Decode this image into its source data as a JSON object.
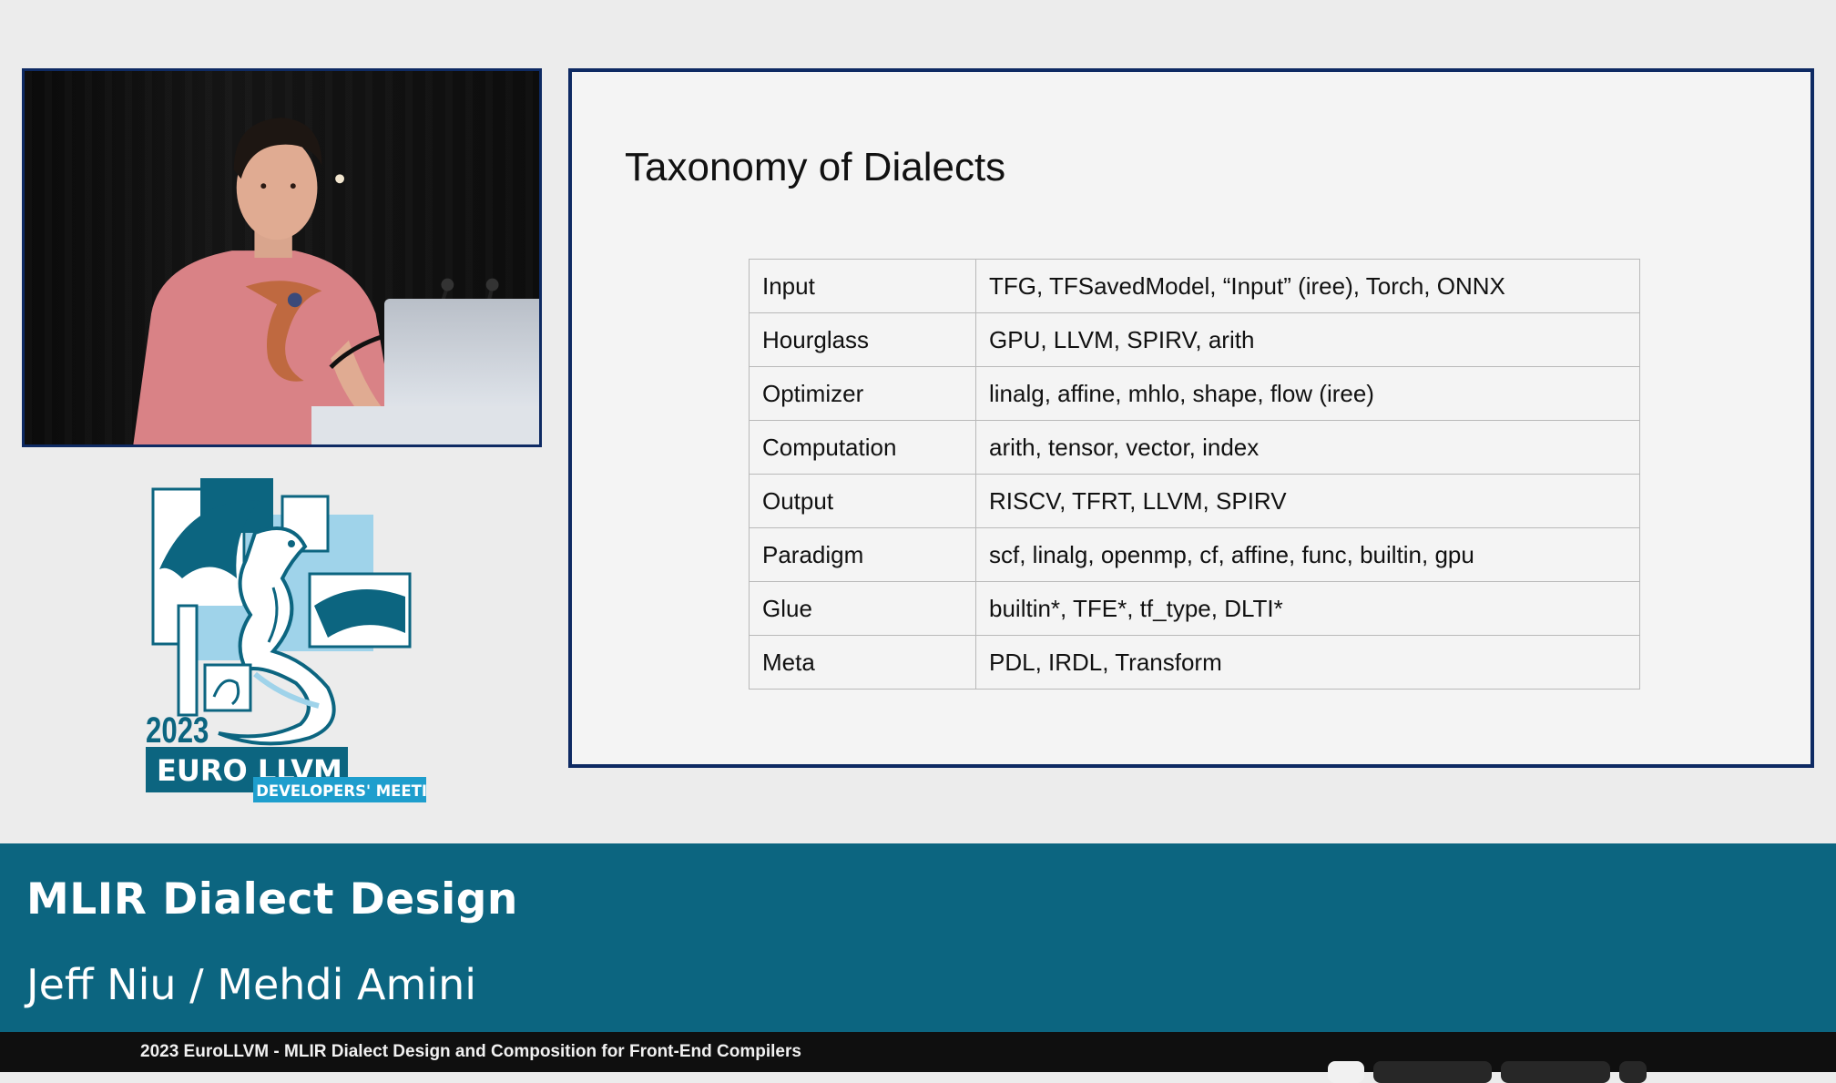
{
  "slide": {
    "title": "Taxonomy of Dialects",
    "rows": [
      {
        "category": "Input",
        "dialects": "TFG, TFSavedModel, “Input” (iree), Torch, ONNX"
      },
      {
        "category": "Hourglass",
        "dialects": "GPU, LLVM, SPIRV, arith"
      },
      {
        "category": "Optimizer",
        "dialects": "linalg, affine, mhlo, shape, flow (iree)"
      },
      {
        "category": "Computation",
        "dialects": "arith, tensor, vector, index"
      },
      {
        "category": "Output",
        "dialects": "RISCV, TFRT, LLVM, SPIRV"
      },
      {
        "category": "Paradigm",
        "dialects": "scf, linalg, openmp, cf, affine, func, builtin, gpu"
      },
      {
        "category": "Glue",
        "dialects": "builtin*, TFE*, tf_type, DLTI*"
      },
      {
        "category": "Meta",
        "dialects": "PDL, IRDL, Transform"
      }
    ]
  },
  "logo": {
    "year": "2023",
    "name": "EURO LLVM",
    "subtitle": "DEVELOPERS' MEETING"
  },
  "banner": {
    "title": "MLIR Dialect Design",
    "speakers": "Jeff Niu / Mehdi Amini"
  },
  "player": {
    "video_title": "2023 EuroLLVM - MLIR Dialect Design and Composition for Front-End Compilers"
  },
  "colors": {
    "slide_border": "#0e2a63",
    "banner_bg": "#0c6580",
    "logo_teal": "#0c6580",
    "logo_light_blue": "#9fd3ea"
  }
}
